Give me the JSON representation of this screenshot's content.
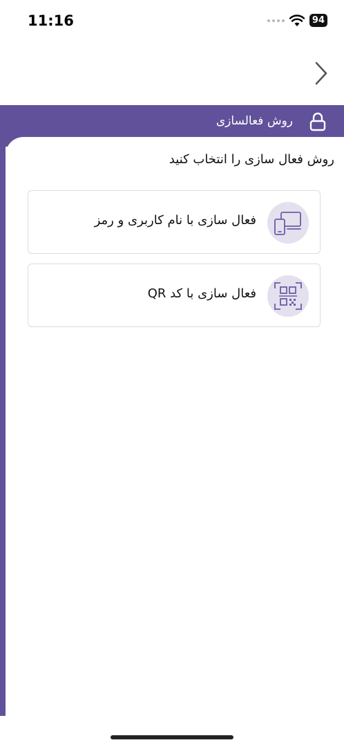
{
  "status_bar": {
    "time": "11:16",
    "battery": "94"
  },
  "header": {
    "title": "روش فعالسازی",
    "lock_icon": "lock-icon",
    "color": "#60519a"
  },
  "main": {
    "heading": "روش فعال سازی را انتخاب کنید",
    "options": [
      {
        "label": "فعال سازی با نام کاربری و رمز",
        "icon": "devices-icon"
      },
      {
        "label": "فعال سازی با کد QR",
        "icon": "qr-code-icon"
      }
    ]
  },
  "nav": {
    "back_icon": "chevron-right-icon"
  }
}
